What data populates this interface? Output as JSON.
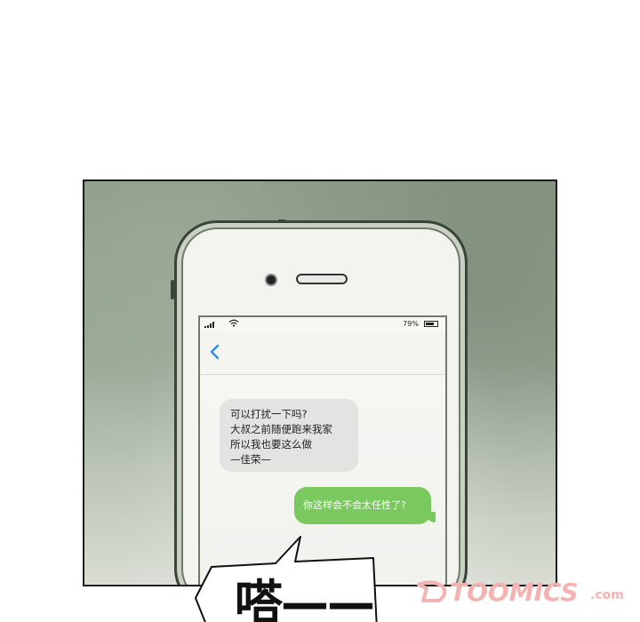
{
  "phone": {
    "status_bar": {
      "battery_text": "79%",
      "battery_level": 0.79,
      "wifi_icon": "wifi-icon",
      "signal_icon": "signal-bars-icon"
    },
    "nav": {
      "back_icon": "chevron-left-icon",
      "accent_color": "#2f8cf0"
    },
    "messages": {
      "received": {
        "line1": "可以打扰一下吗?",
        "line2": "大叔之前随便跑来我家",
        "line3": "所以我也要这么做",
        "line4": "—佳荣—"
      },
      "sent": {
        "text": "你这样会不会太任性了?",
        "color": "#7ac95e"
      }
    }
  },
  "sound_effect": {
    "text": "嗒——"
  },
  "watermark": {
    "text": "TOOMICS",
    "suffix": ".com",
    "color": "#f4b3b0"
  }
}
